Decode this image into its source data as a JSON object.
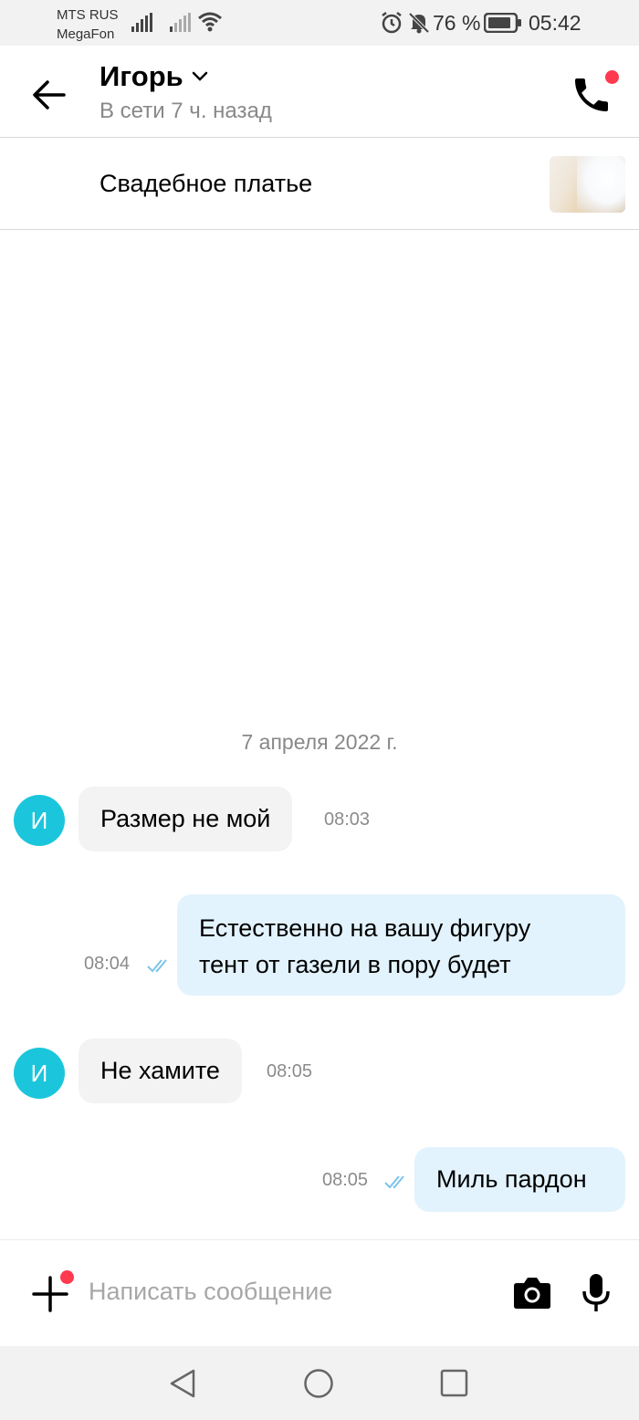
{
  "status_bar": {
    "carrier_1": "MTS RUS",
    "carrier_2": "MegaFon",
    "battery_percent": "76 %",
    "time": "05:42",
    "icons": [
      "signal-icon",
      "signal-weak-icon",
      "wifi-icon",
      "alarm-icon",
      "bell-muted-icon",
      "battery-icon"
    ]
  },
  "header": {
    "contact_name": "Игорь",
    "contact_status": "В сети 7 ч. назад",
    "icons": [
      "back-arrow-icon",
      "chevron-down-icon",
      "phone-icon"
    ]
  },
  "product": {
    "title": "Свадебное платье"
  },
  "chat": {
    "date_separator": "7 апреля 2022 г.",
    "messages": [
      {
        "direction": "in",
        "avatar": "И",
        "text": "Размер не мой",
        "time": "08:03"
      },
      {
        "direction": "out",
        "lines": [
          "Естественно на вашу фигуру",
          "тент от газели в пору будет"
        ],
        "time": "08:04",
        "read": true
      },
      {
        "direction": "in",
        "avatar": "И",
        "text": "Не хамите",
        "time": "08:05"
      },
      {
        "direction": "out",
        "text": "Миль пардон",
        "time": "08:05",
        "read": true
      }
    ]
  },
  "composer": {
    "placeholder": "Написать сообщение",
    "value": "",
    "icons": [
      "plus-icon",
      "camera-icon",
      "microphone-icon"
    ]
  },
  "colors": {
    "avatar": "#1bc6dc",
    "incoming_bubble": "#f3f3f3",
    "outgoing_bubble": "#e3f3fd",
    "notification_dot": "#ff3a4f",
    "read_check": "#7cc4ea"
  }
}
